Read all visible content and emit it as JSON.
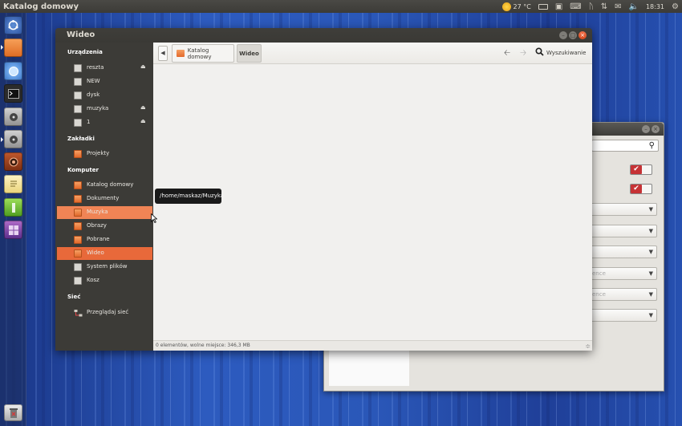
{
  "top_panel": {
    "app_title": "Katalog domowy",
    "weather": "27 °C",
    "clock": "18:31"
  },
  "main_window": {
    "title": "Wideo",
    "sidebar": {
      "devices_heading": "Urządzenia",
      "devices": [
        {
          "label": "reszta",
          "ejectable": true
        },
        {
          "label": "NEW",
          "ejectable": false
        },
        {
          "label": "dysk",
          "ejectable": false
        },
        {
          "label": "muzyka",
          "ejectable": true
        },
        {
          "label": "1",
          "ejectable": true
        }
      ],
      "bookmarks_heading": "Zakładki",
      "bookmarks": [
        {
          "label": "Projekty"
        }
      ],
      "computer_heading": "Komputer",
      "computer": [
        {
          "label": "Katalog domowy",
          "state": "normal"
        },
        {
          "label": "Dokumenty",
          "state": "normal"
        },
        {
          "label": "Muzyka",
          "state": "hover"
        },
        {
          "label": "Obrazy",
          "state": "normal"
        },
        {
          "label": "Pobrane",
          "state": "normal"
        },
        {
          "label": "Wideo",
          "state": "selected"
        },
        {
          "label": "System plików",
          "state": "normal"
        },
        {
          "label": "Kosz",
          "state": "normal"
        }
      ],
      "network_heading": "Sieć",
      "network": [
        {
          "label": "Przeglądaj sieć"
        }
      ]
    },
    "toolbar": {
      "breadcrumb_home": "Katalog domowy",
      "breadcrumb_current": "Wideo",
      "search_label": "Wyszukiwanie"
    },
    "status_text": "0 elementów, wolne miejsce: 346,3 MB"
  },
  "tooltip": {
    "text": "/home/maskaz/Muzyka"
  },
  "background_window": {
    "dropdowns": [
      {
        "text": ""
      },
      {
        "text": ""
      },
      {
        "text": ""
      },
      {
        "text": "ence"
      },
      {
        "text": "ence"
      },
      {
        "text": ""
      }
    ]
  },
  "colors": {
    "accent_orange": "#e8693a",
    "hover_orange": "#f08455",
    "panel_dark": "#3c3b37",
    "close_button": "#d74b20",
    "toggle_red": "#c63235"
  }
}
